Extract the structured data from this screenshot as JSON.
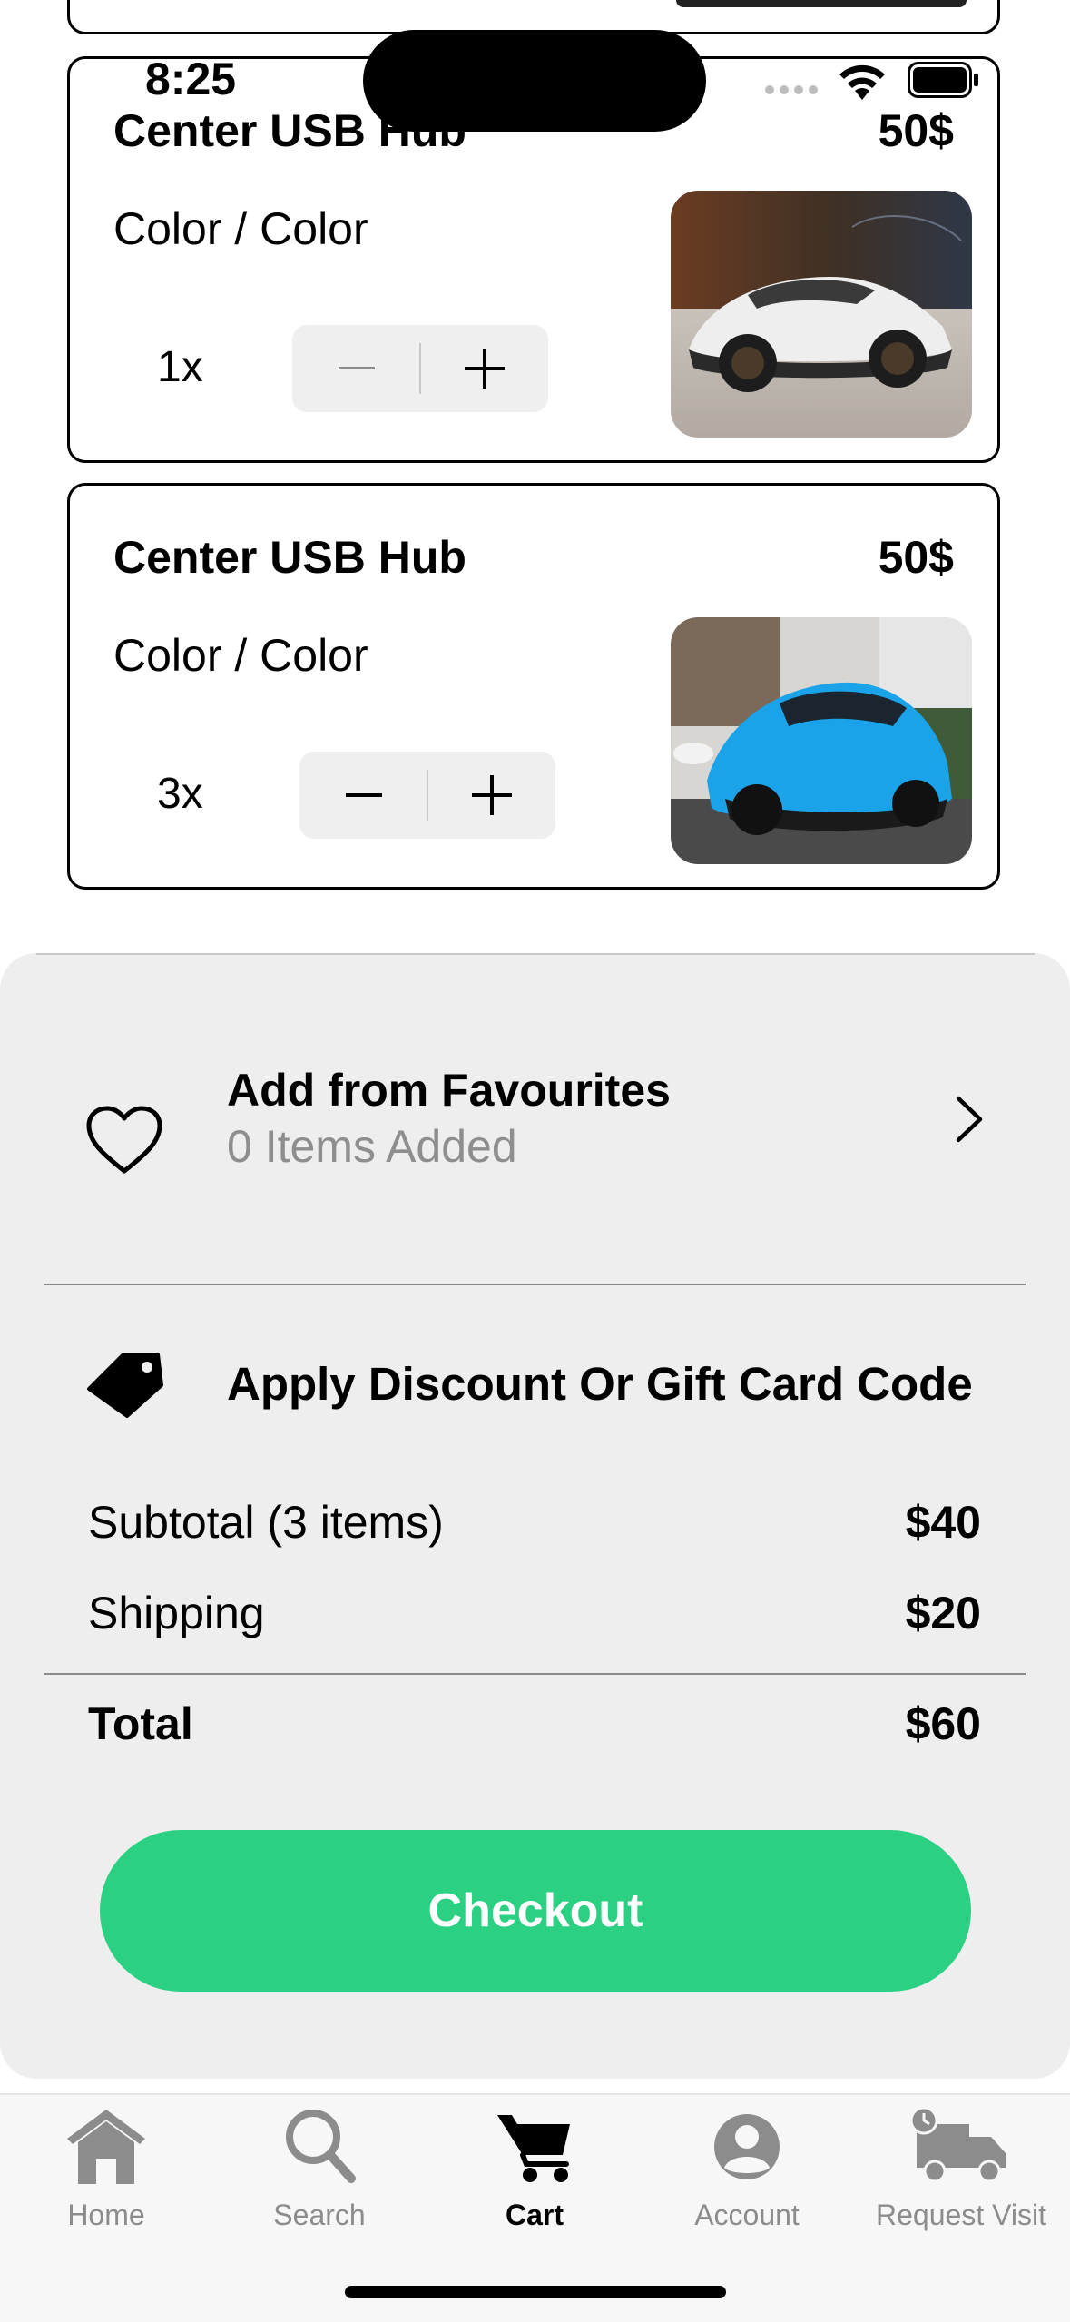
{
  "status_bar": {
    "time": "8:25"
  },
  "cart_items": [
    {
      "title": "Center USB Hub",
      "price": "50$",
      "variant": "Color / Color",
      "quantity": "1x",
      "image": "white-sports-car"
    },
    {
      "title": "Center USB Hub",
      "price": "50$",
      "variant": "Color / Color",
      "quantity": "3x",
      "image": "blue-sports-car"
    }
  ],
  "favourites": {
    "title": "Add from Favourites",
    "subtitle": "0 Items Added"
  },
  "discount": {
    "label": "Apply Discount Or Gift Card Code"
  },
  "summary": {
    "subtotal_label": "Subtotal (3 items)",
    "subtotal_value": "$40",
    "shipping_label": "Shipping",
    "shipping_value": "$20",
    "total_label": "Total",
    "total_value": "$60"
  },
  "checkout": {
    "label": "Checkout"
  },
  "tabs": [
    {
      "label": "Home",
      "icon": "home-icon"
    },
    {
      "label": "Search",
      "icon": "search-icon"
    },
    {
      "label": "Cart",
      "icon": "cart-icon",
      "active": true
    },
    {
      "label": "Account",
      "icon": "account-icon"
    },
    {
      "label": "Request Visit",
      "icon": "truck-icon"
    }
  ],
  "colors": {
    "accent": "#2bd082",
    "panel": "#eeeeee",
    "muted": "#8e8e8e"
  }
}
